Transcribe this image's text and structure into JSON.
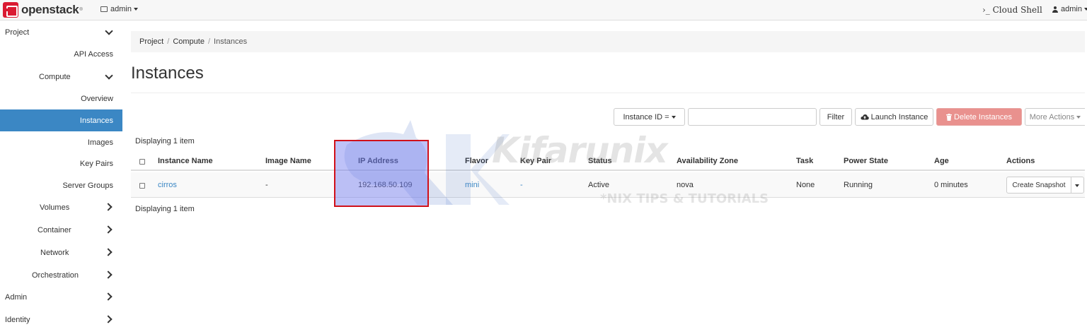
{
  "topbar": {
    "brand": "openstack",
    "brand_tm": "®",
    "project_selector": "admin",
    "cloud_shell": "›_ Cloud Shell",
    "user": "admin"
  },
  "sidebar": {
    "items": [
      {
        "label": "Project"
      },
      {
        "label": "API Access"
      },
      {
        "label": "Compute"
      },
      {
        "label": "Overview"
      },
      {
        "label": "Instances"
      },
      {
        "label": "Images"
      },
      {
        "label": "Key Pairs"
      },
      {
        "label": "Server Groups"
      },
      {
        "label": "Volumes"
      },
      {
        "label": "Container"
      },
      {
        "label": "Network"
      },
      {
        "label": "Orchestration"
      },
      {
        "label": "Admin"
      },
      {
        "label": "Identity"
      }
    ]
  },
  "breadcrumb": [
    "Project",
    "Compute",
    "Instances"
  ],
  "page_title": "Instances",
  "toolbar": {
    "filter_field": "Instance ID =",
    "filter_value": "",
    "filter_button": "Filter",
    "launch_button": "Launch Instance",
    "delete_button": "Delete Instances",
    "more_button": "More Actions"
  },
  "display_count": "Displaying 1 item",
  "table": {
    "columns": [
      "Instance Name",
      "Image Name",
      "IP Address",
      "Flavor",
      "Key Pair",
      "Status",
      "Availability Zone",
      "Task",
      "Power State",
      "Age",
      "Actions"
    ],
    "rows": [
      {
        "instance_name": "cirros",
        "image_name": "-",
        "ip_address": "192.168.50.109",
        "flavor": "mini",
        "key_pair": "-",
        "status": "Active",
        "availability_zone": "nova",
        "task": "None",
        "power_state": "Running",
        "age": "0 minutes",
        "action": "Create Snapshot"
      }
    ]
  },
  "watermark": {
    "text": "Kifarunix",
    "subtext": "*NIX TIPS & TUTORIALS"
  },
  "colors": {
    "active_nav": "#3b87c4",
    "link": "#3b87c4",
    "danger_button": "#e9918e",
    "highlight_border": "#d0101a",
    "brand_red": "#da1a32"
  }
}
